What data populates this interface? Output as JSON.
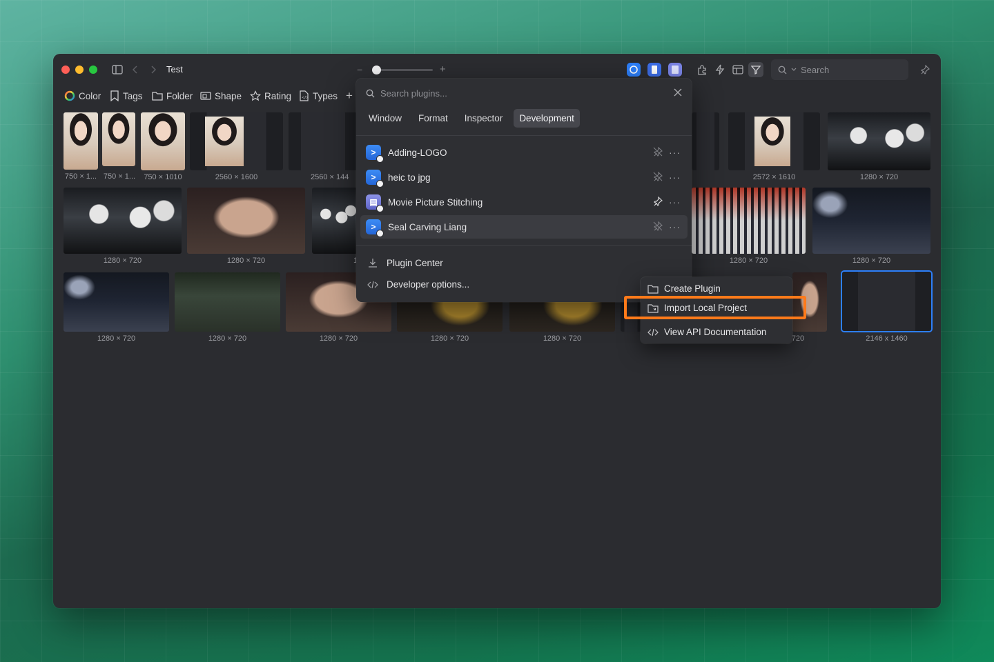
{
  "window": {
    "title": "Test"
  },
  "search": {
    "placeholder": "Search"
  },
  "filters": [
    {
      "label": "Color"
    },
    {
      "label": "Tags"
    },
    {
      "label": "Folder"
    },
    {
      "label": "Shape"
    },
    {
      "label": "Rating"
    },
    {
      "label": "Types"
    }
  ],
  "thumbnails": [
    {
      "label": "750 × 1..."
    },
    {
      "label": "750 × 1..."
    },
    {
      "label": "750 × 1010"
    },
    {
      "label": "2560 × 1600"
    },
    {
      "label": "2560 × 144"
    },
    {
      "label": "2572 × 1610"
    },
    {
      "label": "1280 × 720"
    },
    {
      "label": "1280 × 720"
    },
    {
      "label": "1280 × 720"
    },
    {
      "label": "1"
    },
    {
      "label": "1280 × 720"
    },
    {
      "label": "1280 × 720"
    },
    {
      "label": "1280 × 720"
    },
    {
      "label": "1280 × 720"
    },
    {
      "label": "1280 × 720"
    },
    {
      "label": "1280 × 720"
    },
    {
      "label": "1280 × 720"
    },
    {
      "label": "720"
    },
    {
      "label": "2146 x 1460"
    }
  ],
  "plugin_popover": {
    "search_placeholder": "Search plugins...",
    "tabs": [
      "Window",
      "Format",
      "Inspector",
      "Development"
    ],
    "active_tab": "Development",
    "plugins": [
      {
        "name": "Adding-LOGO",
        "pinned": false
      },
      {
        "name": "heic to jpg",
        "pinned": false
      },
      {
        "name": "Movie Picture Stitching",
        "pinned": true
      },
      {
        "name": "Seal Carving Liang",
        "pinned": false
      }
    ],
    "actions": {
      "plugin_center": "Plugin Center",
      "developer_options": "Developer options..."
    }
  },
  "context_menu": {
    "items": [
      "Create Plugin",
      "Import Local Project",
      "View API Documentation"
    ],
    "highlighted": "Import Local Project"
  },
  "colors": {
    "highlight": "#ff7a1a",
    "accent": "#2d7ff9",
    "window_bg": "#2b2c30"
  }
}
